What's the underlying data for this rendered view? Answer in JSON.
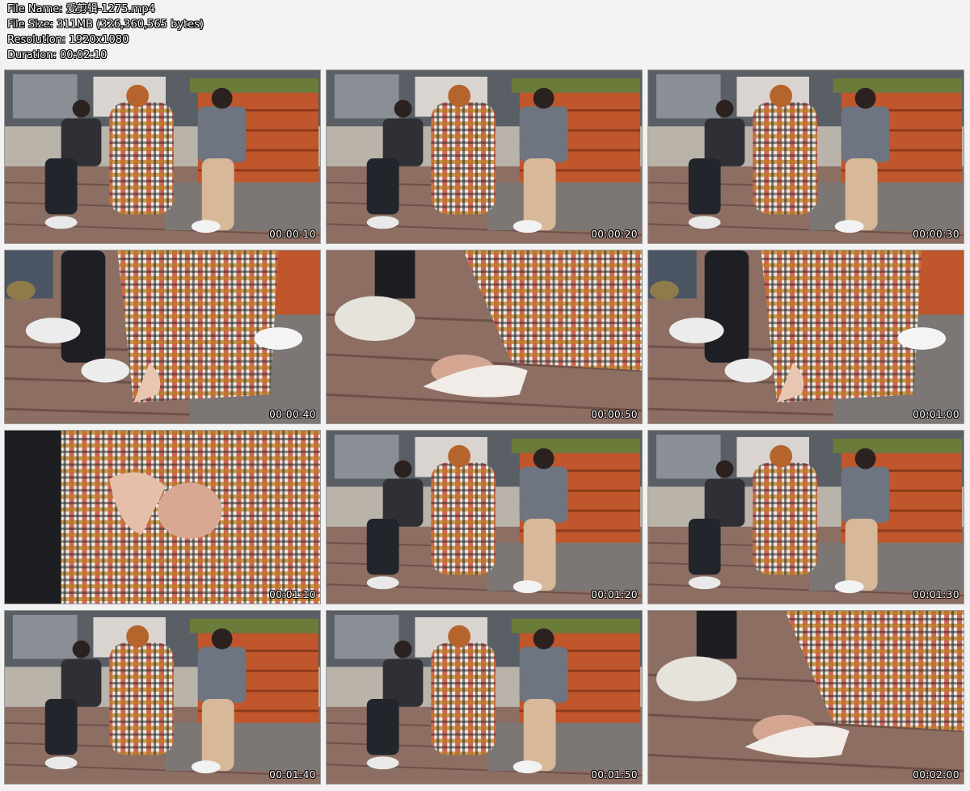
{
  "file_info": {
    "name_line": "File Name: 爱剪辑-1275.mp4",
    "size_line": "File Size: 311MB (326,360,565 bytes)",
    "resolution_line": "Resolution: 1920x1080",
    "duration_line": "Duration: 00:02:10"
  },
  "thumbnails": [
    {
      "time": "00:00:10",
      "scene": "wide"
    },
    {
      "time": "00:00:20",
      "scene": "wide"
    },
    {
      "time": "00:00:30",
      "scene": "wide"
    },
    {
      "time": "00:00:40",
      "scene": "medium"
    },
    {
      "time": "00:00:50",
      "scene": "closeup"
    },
    {
      "time": "00:01:00",
      "scene": "medium"
    },
    {
      "time": "00:01:10",
      "scene": "closeup"
    },
    {
      "time": "00:01:20",
      "scene": "wide"
    },
    {
      "time": "00:01:30",
      "scene": "wide"
    },
    {
      "time": "00:01:40",
      "scene": "wide"
    },
    {
      "time": "00:01:50",
      "scene": "wide"
    },
    {
      "time": "00:02:00",
      "scene": "closeup"
    }
  ]
}
